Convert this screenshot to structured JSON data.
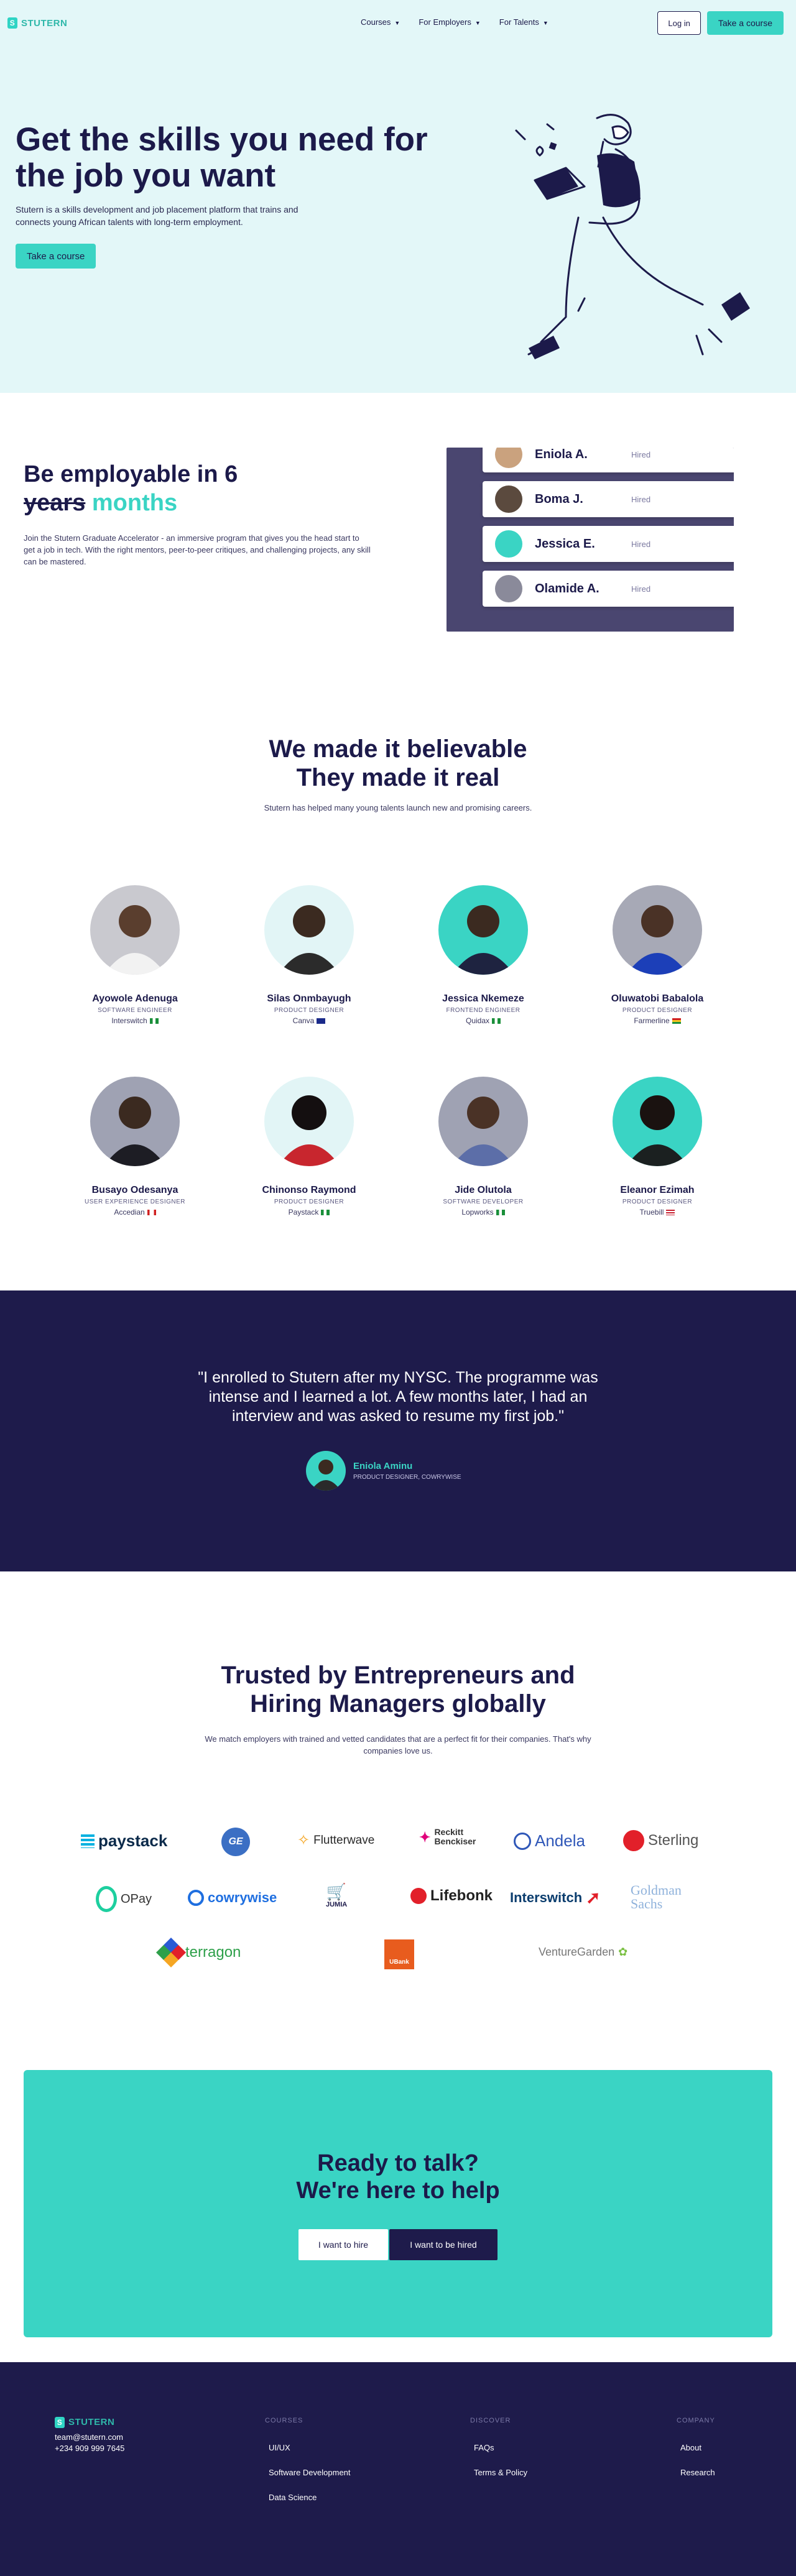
{
  "nav": {
    "brand": "STUTERN",
    "brand_initial": "S",
    "menu": [
      {
        "label": "Courses"
      },
      {
        "label": "For Employers"
      },
      {
        "label": "For Talents"
      }
    ],
    "login_label": "Log in",
    "cta_label": "Take a course"
  },
  "hero": {
    "title": "Get the skills you need for the job you want",
    "description": "Stutern is a skills development and job placement platform that trains and connects young African talents with long-term employment.",
    "button_label": "Take a course"
  },
  "employable": {
    "title_prefix": "Be employable in 6",
    "title_struck": "years",
    "title_highlight": "months",
    "description": "Join the Stutern Graduate Accelerator - an immersive program that gives you the head start to get a job in tech. With the right mentors, peer-to-peer critiques, and challenging projects, any skill can be mastered.",
    "hired": [
      {
        "name": "Eniola A.",
        "status": "Hired"
      },
      {
        "name": "Boma J.",
        "status": "Hired"
      },
      {
        "name": "Jessica E.",
        "status": "Hired"
      },
      {
        "name": "Olamide A.",
        "status": "Hired"
      }
    ]
  },
  "believable": {
    "title_line1": "We made it believable",
    "title_line2": "They made it real",
    "subtitle": "Stutern has helped many young talents launch new and promising careers.",
    "talents": [
      {
        "name": "Ayowole Adenuga",
        "role": "SOFTWARE ENGINEER",
        "company": "Interswitch",
        "flag": "ng"
      },
      {
        "name": "Silas Onmbayugh",
        "role": "PRODUCT DESIGNER",
        "company": "Canva",
        "flag": "au"
      },
      {
        "name": "Jessica Nkemeze",
        "role": "FRONTEND ENGINEER",
        "company": "Quidax",
        "flag": "ng"
      },
      {
        "name": "Oluwatobi Babalola",
        "role": "PRODUCT DESIGNER",
        "company": "Farmerline",
        "flag": "gh"
      },
      {
        "name": "Busayo Odesanya",
        "role": "USER EXPERIENCE DESIGNER",
        "company": "Accedian",
        "flag": "ca"
      },
      {
        "name": "Chinonso Raymond",
        "role": "PRODUCT DESIGNER",
        "company": "Paystack",
        "flag": "ng"
      },
      {
        "name": "Jide Olutola",
        "role": "SOFTWARE DEVELOPER",
        "company": "Lopworks",
        "flag": "ng"
      },
      {
        "name": "Eleanor Ezimah",
        "role": "PRODUCT DESIGNER",
        "company": "Truebill",
        "flag": "us"
      }
    ]
  },
  "testimonial": {
    "quote": "\"I enrolled to Stutern after my NYSC. The programme was intense and I learned a lot. A few months later, I had an interview and was asked to resume my first job.\"",
    "name": "Eniola Aminu",
    "role": "PRODUCT DESIGNER, COWRYWISE"
  },
  "trusted": {
    "title_line1": "Trusted by Entrepreneurs and",
    "title_line2": "Hiring Managers globally",
    "description": "We match employers with trained and vetted candidates that are a perfect fit for their companies. That's why companies love us.",
    "logos": [
      {
        "name": "paystack"
      },
      {
        "name": "GE"
      },
      {
        "name": "Flutterwave"
      },
      {
        "name": "Reckitt Benckiser"
      },
      {
        "name": "Andela"
      },
      {
        "name": "Sterling"
      },
      {
        "name": "OPay"
      },
      {
        "name": "cowrywise"
      },
      {
        "name": "JUMIA"
      },
      {
        "name": "Lifebonk"
      },
      {
        "name": "Interswitch"
      },
      {
        "name": "Goldman Sachs"
      },
      {
        "name": "terragon"
      },
      {
        "name": "UBank"
      },
      {
        "name": "VentureGarden"
      }
    ]
  },
  "cta": {
    "title_line1": "Ready to talk?",
    "title_line2": "We're here to help",
    "hire_label": "I want to hire",
    "hired_label": "I want to be hired"
  },
  "footer": {
    "brand": "STUTERN",
    "email": "team@stutern.com",
    "phone": "+234 909 999 7645",
    "columns": [
      {
        "heading": "COURSES",
        "links": [
          "UI/UX",
          "Software Development",
          "Data Science"
        ]
      },
      {
        "heading": "DISCOVER",
        "links": [
          "FAQs",
          "Terms & Policy"
        ]
      },
      {
        "heading": "COMPANY",
        "links": [
          "About",
          "Research"
        ]
      }
    ]
  },
  "colors": {
    "navy": "#1e1b4b",
    "teal": "#3ad4c4",
    "hero_bg": "#e3f7f8"
  }
}
